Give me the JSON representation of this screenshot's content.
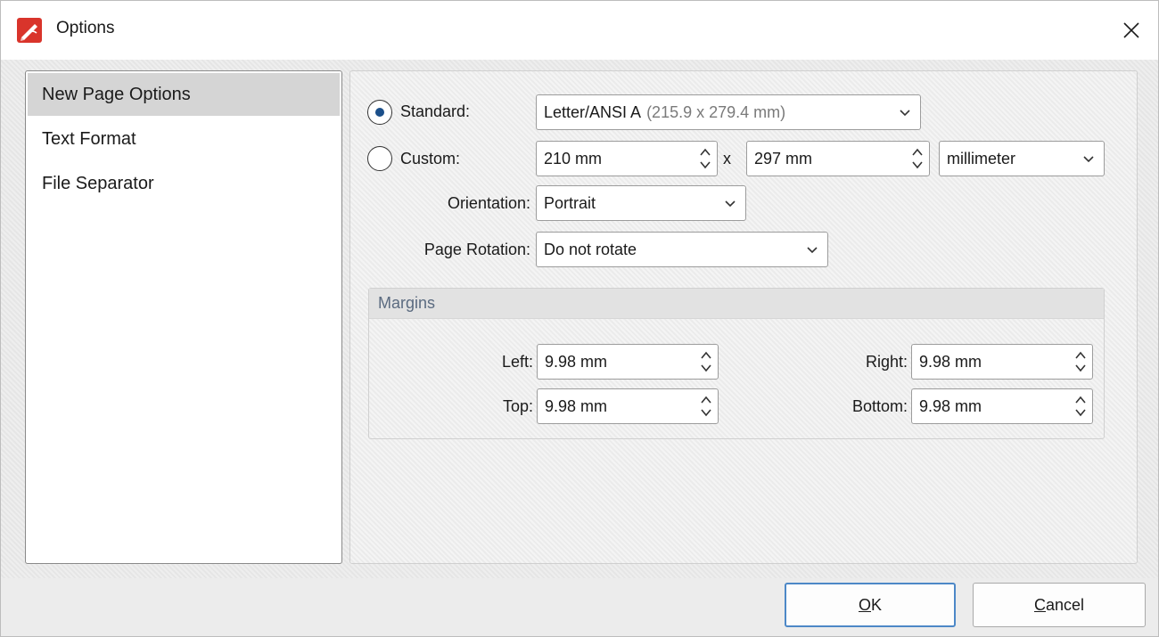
{
  "window": {
    "title": "Options"
  },
  "sidebar": {
    "items": [
      {
        "label": "New Page Options",
        "selected": true
      },
      {
        "label": "Text Format",
        "selected": false
      },
      {
        "label": "File Separator",
        "selected": false
      }
    ]
  },
  "page": {
    "standard_label": "Standard:",
    "standard_value": "Letter/ANSI A",
    "standard_value_detail": "(215.9 x 279.4 mm)",
    "custom_label": "Custom:",
    "custom_width": "210 mm",
    "times_label": "x",
    "custom_height": "297 mm",
    "unit_value": "millimeter",
    "orientation_label": "Orientation:",
    "orientation_value": "Portrait",
    "rotation_label": "Page Rotation:",
    "rotation_value": "Do not rotate",
    "selected_size_mode": "standard"
  },
  "margins": {
    "title": "Margins",
    "left_label": "Left:",
    "left_value": "9.98 mm",
    "right_label": "Right:",
    "right_value": "9.98 mm",
    "top_label": "Top:",
    "top_value": "9.98 mm",
    "bottom_label": "Bottom:",
    "bottom_value": "9.98 mm"
  },
  "footer": {
    "ok_mnemonic": "O",
    "ok_rest": "K",
    "cancel_mnemonic": "C",
    "cancel_rest": "ancel"
  },
  "colors": {
    "radio_accent": "#1b4f8a",
    "primary_button_border": "#4d88c7",
    "app_icon_red": "#d9342b"
  },
  "icons": {
    "app": "pdf-editor-app-icon",
    "close": "close-icon",
    "dropdown": "chevron-down-icon",
    "spinner": "spinner-arrows-icon"
  }
}
